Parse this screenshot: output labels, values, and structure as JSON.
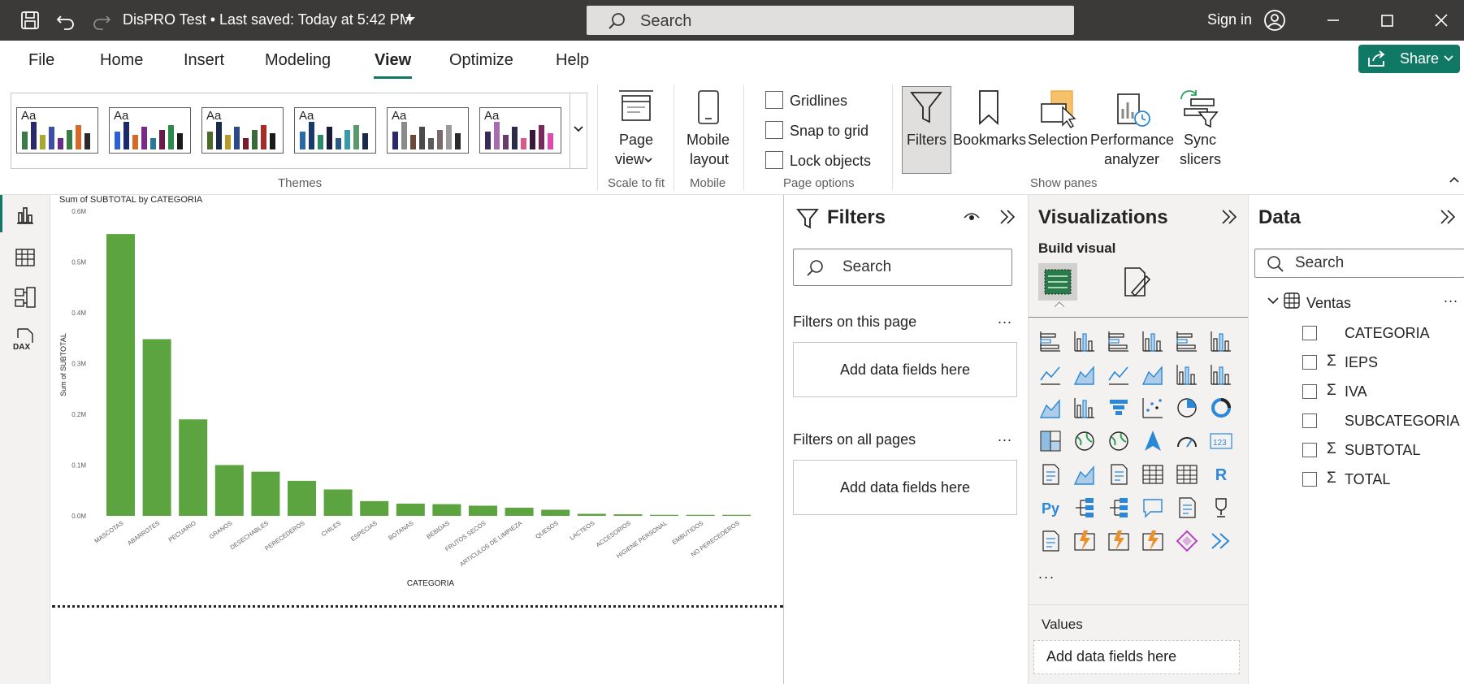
{
  "titlebar": {
    "doc_title": "DisPRO Test • Last saved: Today at 5:42 PM",
    "search_placeholder": "Search",
    "signin_label": "Sign in"
  },
  "ribbon_tabs": [
    "File",
    "Home",
    "Insert",
    "Modeling",
    "View",
    "Optimize",
    "Help"
  ],
  "active_tab": "View",
  "share_label": "Share",
  "ribbon": {
    "themes_label": "Themes",
    "page_view_label1": "Page",
    "page_view_label2": "view",
    "scale_to_fit_label": "Scale to fit",
    "mobile_layout_label1": "Mobile",
    "mobile_layout_label2": "layout",
    "mobile_group_label": "Mobile",
    "gridlines_label": "Gridlines",
    "snap_label": "Snap to grid",
    "lock_label": "Lock objects",
    "page_options_label": "Page options",
    "filters_label": "Filters",
    "bookmarks_label": "Bookmarks",
    "selection_label": "Selection",
    "perf_label1": "Performance",
    "perf_label2": "analyzer",
    "sync_label1": "Sync",
    "sync_label2": "slicers",
    "show_panes_label": "Show panes",
    "theme_swatches": [
      [
        "#3a7d44",
        "#2a2a6a",
        "#a8a832",
        "#3f4fa8",
        "#6a2a8a",
        "#3a7d44",
        "#d66a2a",
        "#2a2a2a"
      ],
      [
        "#2a5fd6",
        "#1a2a6a",
        "#d66a2a",
        "#7a2a8a",
        "#2a7a9a",
        "#6a1a4a",
        "#2a8a4a",
        "#1a1a1a"
      ],
      [
        "#4a6a2a",
        "#1a2a4a",
        "#b89a2a",
        "#2a4a8a",
        "#7a1a2a",
        "#3a6a3a",
        "#a82a2a",
        "#1a1a1a"
      ],
      [
        "#2a6aa8",
        "#1a3a6a",
        "#2a8a6a",
        "#1a1a3a",
        "#2a5a8a",
        "#3a9aa8",
        "#5a9a6a",
        "#1a2a4a"
      ],
      [
        "#2a2a6a",
        "#8a8a8a",
        "#6a4a3a",
        "#4a4a4a",
        "#5a5a5a",
        "#7a6a6a",
        "#9a9a9a",
        "#2a2a2a"
      ],
      [
        "#3a2a5a",
        "#a86ab0",
        "#6a3a6a",
        "#2a2a4a",
        "#d65a8a",
        "#3a1a3a",
        "#7a2a5a",
        "#e04ab0"
      ]
    ]
  },
  "chart_data": {
    "type": "bar",
    "title": "Sum of SUBTOTAL by CATEGORIA",
    "xlabel": "CATEGORIA",
    "ylabel": "Sum of SUBTOTAL",
    "y_ticks": [
      "0.0M",
      "0.1M",
      "0.2M",
      "0.3M",
      "0.4M",
      "0.5M",
      "0.6M"
    ],
    "ylim": [
      0,
      0.6
    ],
    "categories": [
      "MASCOTAS",
      "ABARROTES",
      "PECUARIO",
      "GRANOS",
      "DESECHABLES",
      "PERECEDEROS",
      "CHILES",
      "ESPECIAS",
      "BOTANAS",
      "BEBIDAS",
      "FRUTOS SECOS",
      "ARTICULOS DE LIMPIEZA",
      "QUESOS",
      "LACTEOS",
      "ACCESORIOS",
      "HIGIENE PERSONAL",
      "EMBUTIDOS",
      "NO PERECEDEROS"
    ],
    "values": [
      0.555,
      0.348,
      0.19,
      0.1,
      0.087,
      0.069,
      0.052,
      0.029,
      0.024,
      0.023,
      0.02,
      0.016,
      0.012,
      0.004,
      0.003,
      0.002,
      0.002,
      0.002
    ],
    "bar_color": "#5ba43f",
    "grid": false
  },
  "filters_pane": {
    "title": "Filters",
    "search_placeholder": "Search",
    "on_this_page": "Filters on this page",
    "on_all_pages": "Filters on all pages",
    "add_fields": "Add data fields here",
    "ellipsis": "..."
  },
  "viz_pane": {
    "title": "Visualizations",
    "build_visual": "Build visual",
    "more": "...",
    "values_label": "Values",
    "add_fields": "Add data fields here",
    "icons": [
      "stacked-bar-chart-icon",
      "stacked-column-chart-icon",
      "clustered-bar-chart-icon",
      "clustered-column-chart-icon",
      "100-stacked-bar-chart-icon",
      "100-stacked-column-chart-icon",
      "line-chart-icon",
      "area-chart-icon",
      "stacked-area-chart-icon",
      "100-stacked-area-chart-icon",
      "line-and-stacked-column-icon",
      "line-and-clustered-column-icon",
      "ribbon-chart-icon",
      "waterfall-chart-icon",
      "funnel-chart-icon",
      "scatter-chart-icon",
      "pie-chart-icon",
      "donut-chart-icon",
      "treemap-icon",
      "map-icon",
      "filled-map-icon",
      "azure-map-icon",
      "gauge-icon",
      "card-icon",
      "multi-row-card-icon",
      "kpi-icon",
      "slicer-icon",
      "table-icon",
      "matrix-icon",
      "r-visual-icon",
      "python-visual-icon",
      "key-influencers-icon",
      "decomposition-tree-icon",
      "qa-icon",
      "smart-narrative-icon",
      "metrics-icon",
      "paginated-report-icon",
      "power-apps-icon",
      "power-automate-icon",
      "custom-visual-icon",
      "powerapps-diamond-icon",
      "power-automate-flow-icon"
    ],
    "py_glyph": "Py",
    "r_glyph": "R",
    "card_glyph": "123"
  },
  "data_pane": {
    "title": "Data",
    "search_placeholder": "Search",
    "table_name": "Ventas",
    "table_ellipsis": "...",
    "fields": [
      {
        "name": "CATEGORIA",
        "sigma": ""
      },
      {
        "name": "IEPS",
        "sigma": "Σ"
      },
      {
        "name": "IVA",
        "sigma": "Σ"
      },
      {
        "name": "SUBCATEGORIA",
        "sigma": ""
      },
      {
        "name": "SUBTOTAL",
        "sigma": "Σ"
      },
      {
        "name": "TOTAL",
        "sigma": "Σ"
      }
    ]
  },
  "leftnav": {
    "dax_glyph": "DAX"
  }
}
